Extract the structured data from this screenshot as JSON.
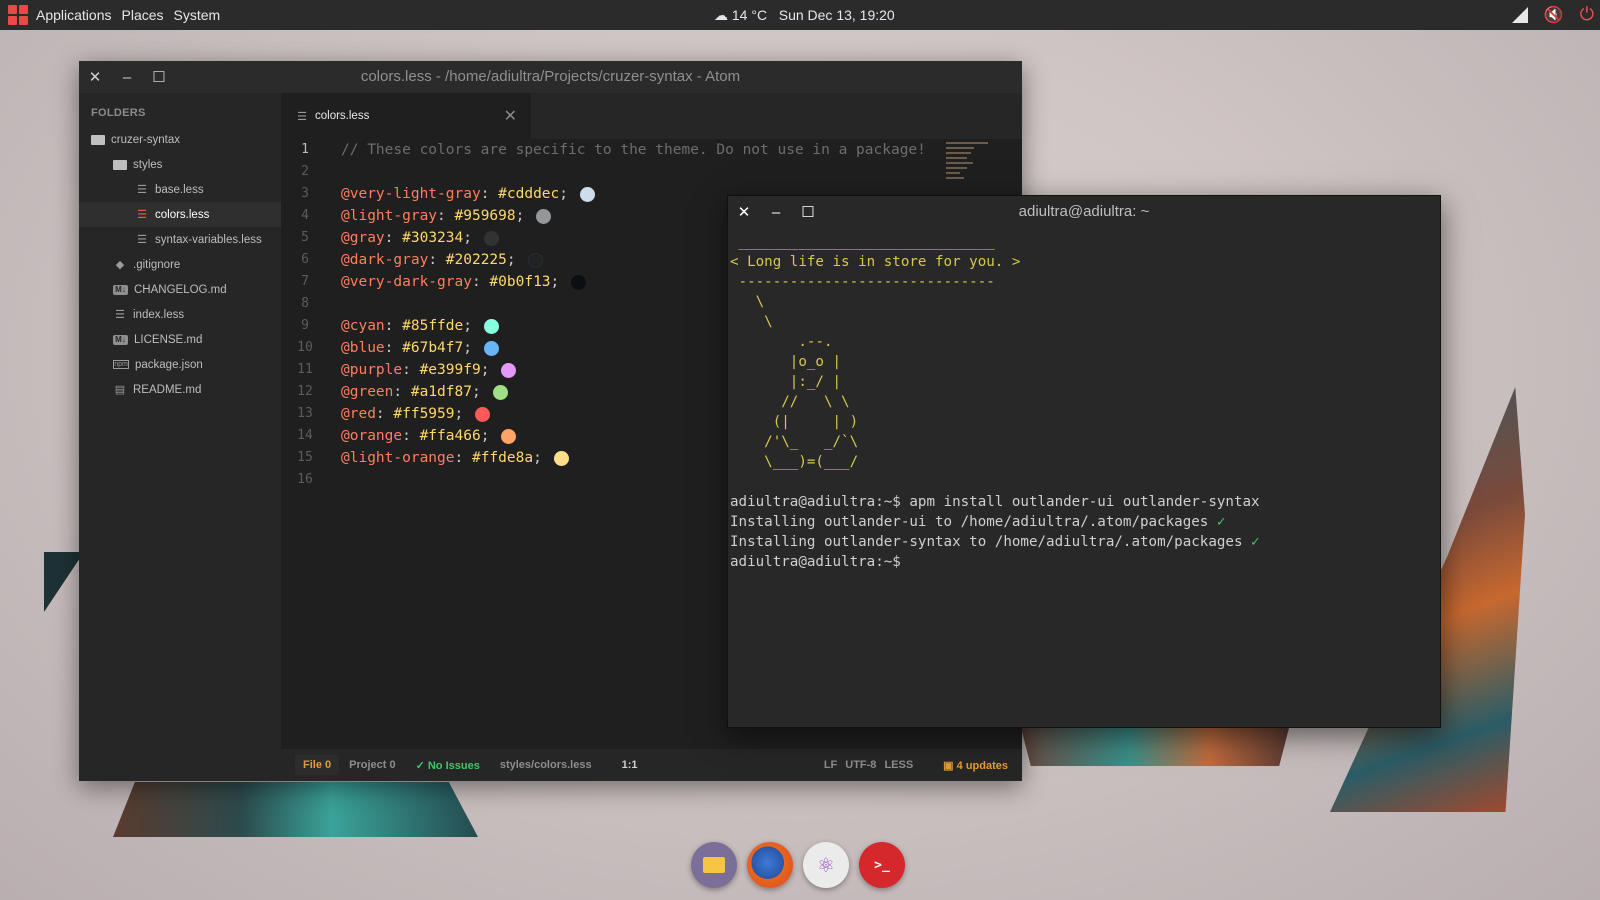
{
  "top_panel": {
    "menus": [
      "Applications",
      "Places",
      "System"
    ],
    "weather": "14 °C",
    "datetime": "Sun Dec 13, 19:20",
    "icons": [
      "apps-grid-icon",
      "weather-icon",
      "signal-icon",
      "volume-muted-icon",
      "power-icon"
    ]
  },
  "atom": {
    "title": "colors.less - /home/adiultra/Projects/cruzer-syntax - Atom",
    "tree": {
      "header": "FOLDERS",
      "items": [
        {
          "label": "cruzer-syntax",
          "icon": "folder-icon"
        },
        {
          "label": "styles",
          "icon": "folder-icon"
        },
        {
          "label": "base.less",
          "icon": "less-file-icon"
        },
        {
          "label": "colors.less",
          "icon": "less-file-icon"
        },
        {
          "label": "syntax-variables.less",
          "icon": "less-file-icon"
        },
        {
          "label": ".gitignore",
          "icon": "git-icon"
        },
        {
          "label": "CHANGELOG.md",
          "icon": "markdown-icon"
        },
        {
          "label": "index.less",
          "icon": "less-file-icon"
        },
        {
          "label": "LICENSE.md",
          "icon": "markdown-icon"
        },
        {
          "label": "package.json",
          "icon": "json-icon"
        },
        {
          "label": "README.md",
          "icon": "readme-icon"
        }
      ]
    },
    "tab": {
      "label": "colors.less"
    },
    "code": {
      "comment": "// These colors are specific to the theme. Do not use in a package!",
      "vars": [
        {
          "line": 3,
          "name": "@very-light-gray",
          "value": "#cdddec",
          "color": "#cdddec"
        },
        {
          "line": 4,
          "name": "@light-gray",
          "value": "#959698",
          "color": "#959698"
        },
        {
          "line": 5,
          "name": "@gray",
          "value": "#303234",
          "color": "#303234"
        },
        {
          "line": 6,
          "name": "@dark-gray",
          "value": "#202225",
          "color": "#202225"
        },
        {
          "line": 7,
          "name": "@very-dark-gray",
          "value": "#0b0f13",
          "color": "#0b0f13"
        },
        {
          "line": 9,
          "name": "@cyan",
          "value": "#85ffde",
          "color": "#85ffde"
        },
        {
          "line": 10,
          "name": "@blue",
          "value": "#67b4f7",
          "color": "#67b4f7"
        },
        {
          "line": 11,
          "name": "@purple",
          "value": "#e399f9",
          "color": "#e399f9"
        },
        {
          "line": 12,
          "name": "@green",
          "value": "#a1df87",
          "color": "#a1df87"
        },
        {
          "line": 13,
          "name": "@red",
          "value": "#ff5959",
          "color": "#ff5959"
        },
        {
          "line": 14,
          "name": "@orange",
          "value": "#ffa466",
          "color": "#ffa466"
        },
        {
          "line": 15,
          "name": "@light-orange",
          "value": "#ffde8a",
          "color": "#ffde8a"
        }
      ],
      "line_numbers": [
        "1",
        "2",
        "3",
        "4",
        "5",
        "6",
        "7",
        "8",
        "9",
        "10",
        "11",
        "12",
        "13",
        "14",
        "15",
        "16"
      ]
    },
    "status": {
      "file": "File 0",
      "project": "Project 0",
      "issues": "✓ No Issues",
      "path": "styles/colors.less",
      "cursor": "1:1",
      "line_ending": "LF",
      "encoding": "UTF-8",
      "grammar": "LESS",
      "updates": "4 updates"
    }
  },
  "terminal": {
    "title": "adiultra@adiultra: ~",
    "fortune_top": " ______________________________",
    "fortune": "< Long life is in store for you. >",
    "fortune_bottom": " ------------------------------",
    "art": "   \\\n    \\\n        .--.\n       |o_o |\n       |:_/ |\n      //   \\ \\\n     (|     | )\n    /'\\_   _/`\\\n    \\___)=(___/",
    "cmd_prompt": "adiultra@adiultra:~$ ",
    "cmd": "apm install outlander-ui outlander-syntax",
    "out1": "Installing outlander-ui to /home/adiultra/.atom/packages ",
    "out2": "Installing outlander-syntax to /home/adiultra/.atom/packages ",
    "check": "✓",
    "final_prompt": "adiultra@adiultra:~$"
  },
  "dock": {
    "items": [
      "files-icon",
      "firefox-icon",
      "atom-icon",
      "terminal-icon"
    ]
  }
}
